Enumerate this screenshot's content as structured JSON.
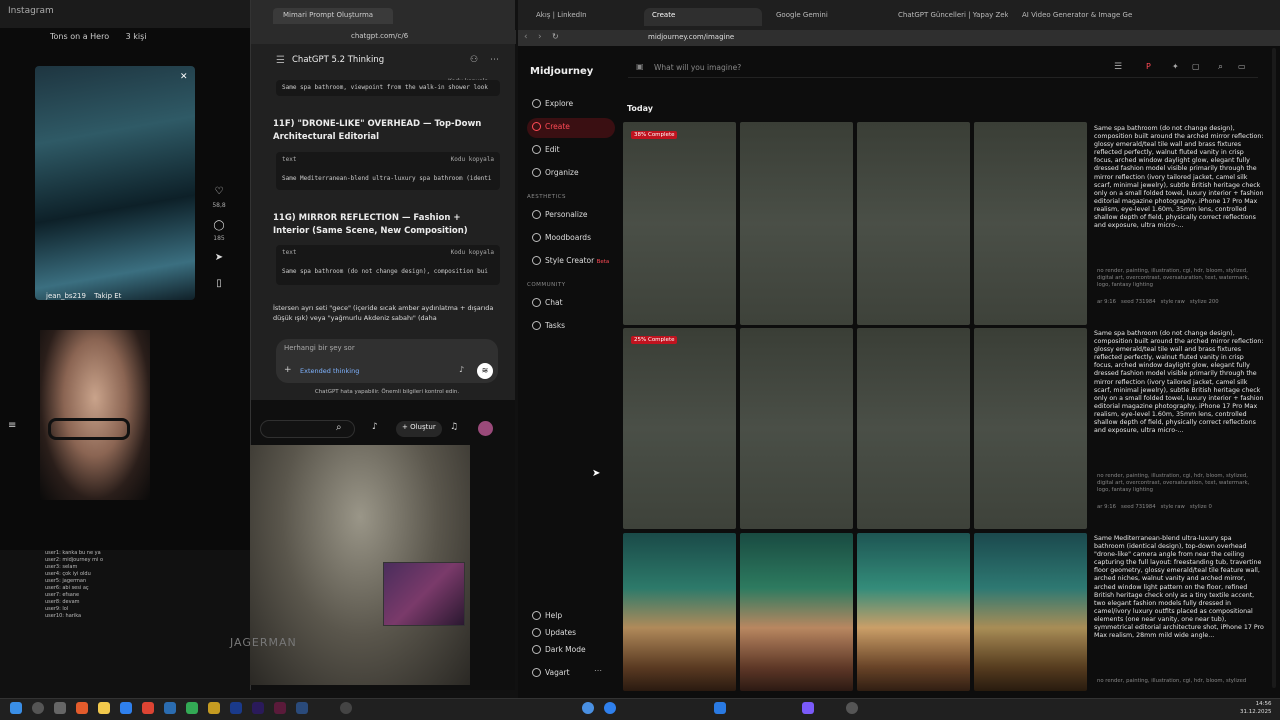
{
  "instagram": {
    "window_title": "Instagram",
    "header_left": "Tons on a Hero",
    "header_right": "3 kişi",
    "likes": "58,8",
    "comments": "185",
    "username": "jean_bs219",
    "follow": "Takip Et"
  },
  "chatlog": [
    "user1: kanka bu ne ya",
    "user2: midjourney mi o",
    "user3: selam",
    "user4: çok iyi oldu",
    "user5: jagerman",
    "user6: abi sesi aç",
    "user7: efsane",
    "user8: devam",
    "user9: lol",
    "user10: harika"
  ],
  "chatgpt": {
    "tab_title": "Mimari Prompt Oluşturma",
    "url": "chatgpt.com/c/6",
    "model": "ChatGPT 5.2 Thinking",
    "code0": "Same spa bathroom, viewpoint from the walk-in shower look",
    "copy_label": "Kodu kopyala",
    "h1": "11F) \"DRONE-LIKE\" OVERHEAD — Top-Down Architectural Editorial",
    "lang": "text",
    "code1": "Same Mediterranean-blend ultra-luxury spa bathroom (identi",
    "h2": "11G) MIRROR REFLECTION — Fashion + Interior (Same Scene, New Composition)",
    "code2": "Same spa bathroom (do not change design), composition bui",
    "para": "İstersen ayrı seti \"gece\" (içeride sıcak amber aydınlatma + dışarıda düşük ışık) veya \"yağmurlu Akdeniz sabahı\" (daha",
    "input_placeholder": "Herhangi bir şey sor",
    "extended": "Extended thinking",
    "disclaimer": "ChatGPT hata yapabilir. Önemli bilgileri kontrol edin."
  },
  "youtube": {
    "create": "Oluştur",
    "watermark": "JAGERMAN"
  },
  "browser": {
    "tabs": [
      "Akış | LinkedIn",
      "Create",
      "Google Gemini",
      "ChatGPT Güncelleri | Yapay Zekalı Gö",
      "AI Video Generator & Image Generat"
    ],
    "url": "midjourney.com/imagine"
  },
  "midjourney": {
    "logo": "Midjourney",
    "search_placeholder": "What will you imagine?",
    "nav": [
      "Explore",
      "Create",
      "Edit",
      "Organize"
    ],
    "aesthetics_label": "AESTHETICS",
    "aesthetics": [
      "Personalize",
      "Moodboards",
      "Style Creator"
    ],
    "beta": "Beta",
    "community_label": "COMMUNITY",
    "community": [
      "Chat",
      "Tasks"
    ],
    "bottom": [
      "Help",
      "Updates",
      "Dark Mode",
      "Vagart"
    ],
    "today": "Today",
    "rows": [
      {
        "progress": "38% Complete",
        "prompt": "Same spa bathroom (do not change design), composition built around the arched mirror reflection: glossy emerald/teal tile wall and brass fixtures reflected perfectly, walnut fluted vanity in crisp focus, arched window daylight glow, elegant fully dressed fashion model visible primarily through the mirror reflection (ivory tailored jacket, camel silk scarf, minimal jewelry), subtle British heritage check only on a small folded towel, luxury interior + fashion editorial magazine photography, iPhone 17 Pro Max realism, eye-level 1.60m, 35mm lens, controlled shallow depth of field, physically correct reflections and exposure, ultra micro-...",
        "neg": "no render, painting, illustration, cgi, hdr, bloom, stylized, digital art, overcontrast, oversaturation, text, watermark, logo, fantasy lighting",
        "meta": "ar 9:16   seed 731984   style raw   stylize 200"
      },
      {
        "progress": "25% Complete",
        "prompt": "Same spa bathroom (do not change design), composition built around the arched mirror reflection: glossy emerald/teal tile wall and brass fixtures reflected perfectly, walnut fluted vanity in crisp focus, arched window daylight glow, elegant fully dressed fashion model visible primarily through the mirror reflection (ivory tailored jacket, camel silk scarf, minimal jewelry), subtle British heritage check only on a small folded towel, luxury interior + fashion editorial magazine photography, iPhone 17 Pro Max realism, eye-level 1.60m, 35mm lens, controlled shallow depth of field, physically correct reflections and exposure, ultra micro-...",
        "neg": "no render, painting, illustration, cgi, hdr, bloom, stylized, digital art, overcontrast, oversaturation, text, watermark, logo, fantasy lighting",
        "meta": "ar 9:16   seed 731984   style raw   stylize 0"
      },
      {
        "progress": "",
        "prompt": "Same Mediterranean-blend ultra-luxury spa bathroom (identical design), top-down overhead \"drone-like\" camera angle from near the ceiling capturing the full layout: freestanding tub, travertine floor geometry, glossy emerald/teal tile feature wall, arched niches, walnut vanity and arched mirror, arched window light pattern on the floor, refined British heritage check only as a tiny textile accent, two elegant fashion models fully dressed in camel/ivory luxury outfits placed as compositional elements (one near vanity, one near tub), symmetrical editorial architecture shot, iPhone 17 Pro Max realism, 28mm mild wide angle...",
        "neg": "no render, painting, illustration, cgi, hdr, bloom, stylized",
        "meta": ""
      }
    ]
  },
  "clock": {
    "time": "14:56",
    "date": "31.12.2025"
  }
}
